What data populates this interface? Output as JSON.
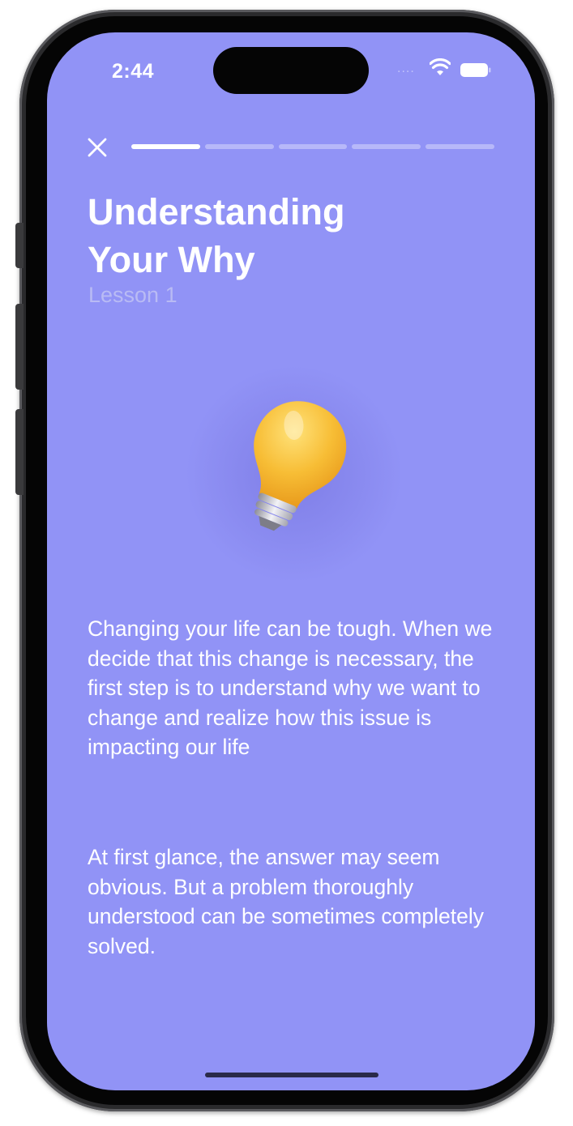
{
  "status_bar": {
    "time": "2:44",
    "signal_dots": "....",
    "wifi_icon": "wifi-icon",
    "battery_icon": "battery-icon"
  },
  "header": {
    "close_icon": "close-icon",
    "progress": {
      "total_steps": 5,
      "current_step": 1
    }
  },
  "lesson": {
    "title": "Understanding Your Why",
    "subtitle": "Lesson 1",
    "illustration": "lightbulb-icon",
    "paragraphs": [
      "Changing your life can be tough. When we decide that this change is necessary, the first step is to understand why we want to change and realize how this issue is impacting our life",
      "At first glance, the answer may seem obvious. But a problem thoroughly understood can be sometimes completely solved."
    ]
  },
  "colors": {
    "background": "#9193f6",
    "text": "#ffffff",
    "subtitle": "#b9bbf4",
    "bulb": "#f5b92e"
  }
}
